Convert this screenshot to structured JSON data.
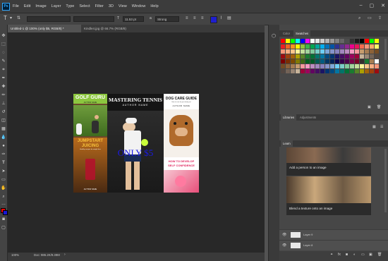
{
  "app": {
    "logo": "Ps"
  },
  "menu": [
    "File",
    "Edit",
    "Image",
    "Layer",
    "Type",
    "Select",
    "Filter",
    "3D",
    "View",
    "Window",
    "Help"
  ],
  "window_controls": [
    "–",
    "▢",
    "✕"
  ],
  "options": {
    "tool_icon": "T",
    "font_size": "11.53 pt",
    "antialias": "Strong",
    "aa_label": "a"
  },
  "tabs": [
    {
      "label": "Untitled-1 @ 100% (only $5, RGB/8) *"
    },
    {
      "label": "Kindle4.jpg @ 66.7% (RGB/8)"
    }
  ],
  "status": {
    "zoom": "100%",
    "doc": "Doc: 986.2K/9.39M"
  },
  "document": {
    "cover1": {
      "title": "GOLF GURU",
      "author": "AUTHOR NAME",
      "subtitle_big": "JUMPSTART",
      "subtitle_big2": "JUICING",
      "tagline": "Healthy recipes for weight loss",
      "bottom_author": "AUTHOR NAME"
    },
    "cover2": {
      "title": "MASTERING TENNIS",
      "author": "AUTHOR NAME",
      "overlay": "ONLY $5"
    },
    "cover3": {
      "title": "DOG CARE GUIDE",
      "small": "How to care for your lovely pet",
      "author": "AUTHOR NAME",
      "heading1": "HOW TO DEVELOP",
      "heading2": "SELF CONFIDENCE"
    }
  },
  "panels": {
    "color_tab": "Color",
    "swatches_tab": "Swatches",
    "libraries_tab": "Libraries",
    "adjustments_tab": "Adjustments",
    "learn_tab": "Learn",
    "learn_items": [
      {
        "label": "Add a person to an image"
      },
      {
        "label": "Blend a texture onto an image"
      }
    ],
    "layers": [
      {
        "name": "Layer 9"
      },
      {
        "name": "Layer 8"
      }
    ]
  },
  "colors": {
    "swatch_row1": [
      "#ff0000",
      "#ffff00",
      "#00ff00",
      "#00ffff",
      "#0000ff",
      "#ff00ff",
      "#ffffff",
      "#e6e6e6",
      "#cccccc",
      "#b3b3b3",
      "#999999",
      "#808080",
      "#666666",
      "#4d4d4d",
      "#333333",
      "#1a1a1a",
      "#000000",
      "#ff0000",
      "#00ff00",
      "#ffff00"
    ],
    "swatch_rows": [
      [
        "#ed1c24",
        "#f26522",
        "#f7941d",
        "#fff200",
        "#8dc63f",
        "#39b54a",
        "#00a651",
        "#00a99d",
        "#00aeef",
        "#0072bc",
        "#0054a6",
        "#2e3192",
        "#662d91",
        "#92278f",
        "#ec008c",
        "#ed145b",
        "#f26c4f",
        "#f69679",
        "#fbad66",
        "#fff568"
      ],
      [
        "#f7977a",
        "#f9ad81",
        "#fdc68a",
        "#fff799",
        "#c4df9b",
        "#a3d39c",
        "#82ca9d",
        "#7bcdc8",
        "#6ecff6",
        "#7ea7d8",
        "#8493ca",
        "#8882be",
        "#a187be",
        "#bc8cbf",
        "#f49ac2",
        "#f6989d",
        "#c69c6d",
        "#a67c52",
        "#8c6239",
        "#754c24"
      ],
      [
        "#9e0b0f",
        "#a0410d",
        "#a3620a",
        "#aba000",
        "#598527",
        "#1a7b30",
        "#007236",
        "#00746b",
        "#0076a3",
        "#004a80",
        "#003471",
        "#1b1464",
        "#440e62",
        "#630460",
        "#9e005d",
        "#9e0039",
        "#c7b299",
        "#998675",
        "#736357",
        "#534741"
      ],
      [
        "#790000",
        "#7b2e00",
        "#7d4900",
        "#827b00",
        "#406618",
        "#005e20",
        "#005826",
        "#005952",
        "#005b7f",
        "#003663",
        "#002157",
        "#0d004c",
        "#32004b",
        "#4b0049",
        "#7b0046",
        "#7a0026",
        "#362f2d",
        "#197b30",
        "#a67c52",
        "#ffffff"
      ]
    ]
  }
}
